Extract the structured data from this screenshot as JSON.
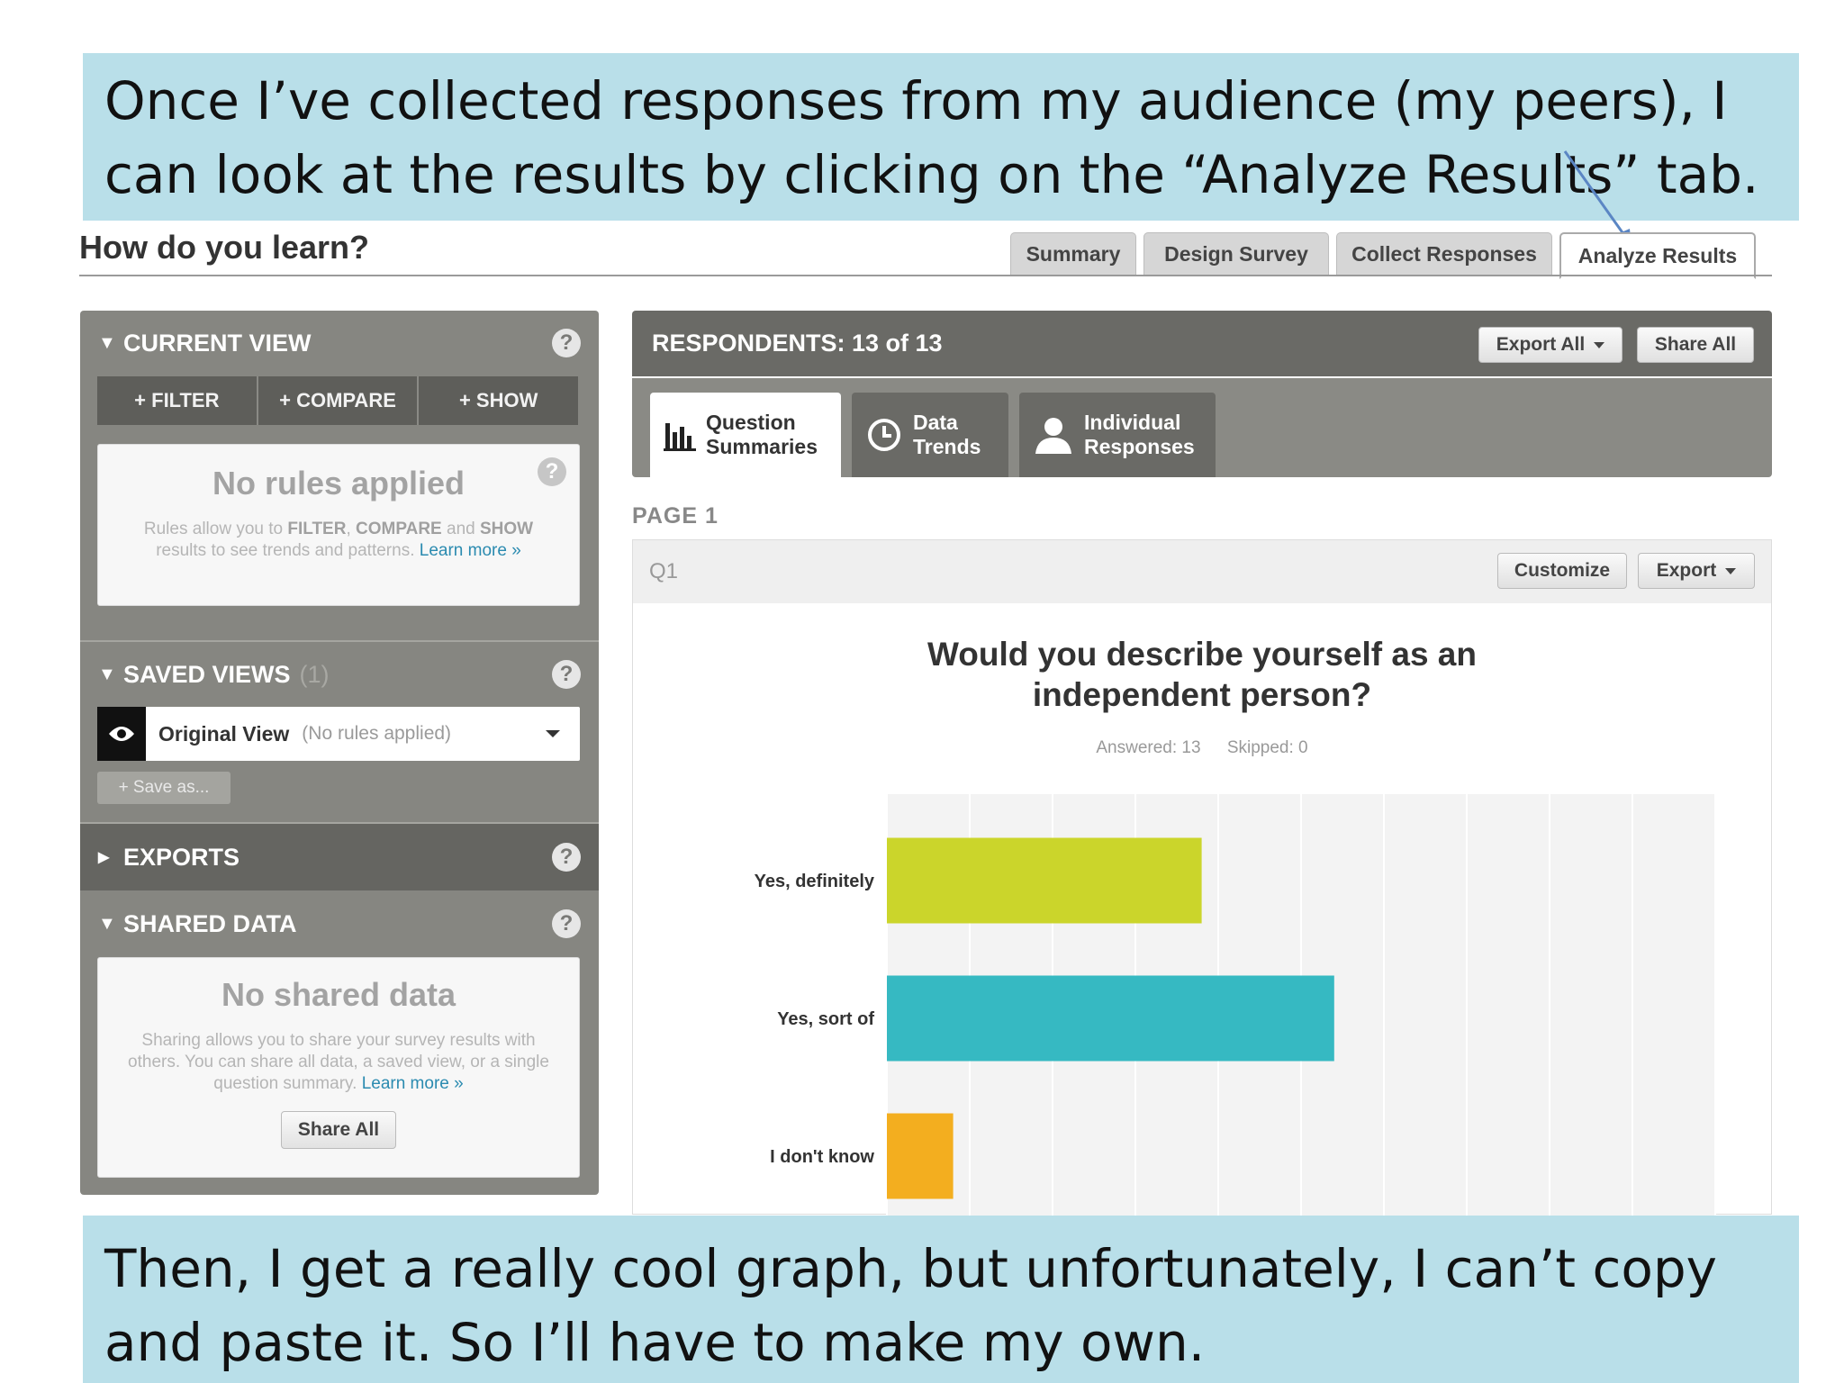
{
  "captions": {
    "top": "Once I’ve collected responses from my audience (my peers), I can look at the results by clicking on the “Analyze Results” tab.",
    "bottom": "Then, I get a really cool graph, but unfortunately, I can’t copy and paste it. So I’ll have to make my own."
  },
  "survey": {
    "title": "How do you learn?"
  },
  "top_tabs": [
    "Summary",
    "Design Survey",
    "Collect Responses",
    "Analyze Results"
  ],
  "sidebar": {
    "current_view": {
      "title": "CURRENT VIEW",
      "buttons": [
        "+ FILTER",
        "+ COMPARE",
        "+ SHOW"
      ],
      "empty_title": "No rules applied",
      "empty_text_1": "Rules allow you to ",
      "kw_filter": "FILTER",
      "sep_1": ", ",
      "kw_compare": "COMPARE",
      "sep_2": " and ",
      "kw_show": "SHOW",
      "empty_text_2": "results to see trends and patterns.",
      "learn_more": "Learn more »"
    },
    "saved_views": {
      "title": "SAVED VIEWS",
      "count": "(1)",
      "view_name": "Original View",
      "view_note": "(No rules applied)",
      "save_as": "+ Save as..."
    },
    "exports": {
      "title": "EXPORTS"
    },
    "shared_data": {
      "title": "SHARED DATA",
      "empty_title": "No shared data",
      "empty_text": "Sharing allows you to share your survey results with others. You can share all data, a saved view, or a single question summary.",
      "learn_more": "Learn more »",
      "share_all": "Share All"
    }
  },
  "main": {
    "respondents": "RESPONDENTS: 13 of 13",
    "export_all": "Export All",
    "share_all": "Share All",
    "subtabs": [
      {
        "line1": "Question",
        "line2": "Summaries",
        "icon": "bar-chart-icon"
      },
      {
        "line1": "Data",
        "line2": "Trends",
        "icon": "clock-icon"
      },
      {
        "line1": "Individual",
        "line2": "Responses",
        "icon": "person-icon"
      }
    ],
    "page_label": "PAGE 1",
    "question": {
      "number": "Q1",
      "customize": "Customize",
      "export": "Export",
      "title_line1": "Would you describe yourself as an",
      "title_line2": "independent person?",
      "answered": "Answered: 13",
      "skipped": "Skipped: 0"
    }
  },
  "chart_data": {
    "type": "bar",
    "orientation": "horizontal",
    "title": "Would you describe yourself as an independent person?",
    "categories": [
      "Yes, definitely",
      "Yes, sort of",
      "I don't know"
    ],
    "values": [
      38,
      54,
      8
    ],
    "colors": [
      "#cbd52b",
      "#36b9c2",
      "#f3ae1f"
    ],
    "xlim": [
      0,
      100
    ],
    "grid": true
  },
  "colors": {
    "caption_bg": "#b9dfe9",
    "sidebar_bg": "#868681",
    "header_bg": "#6a6a66",
    "link": "#2b8bb0"
  }
}
